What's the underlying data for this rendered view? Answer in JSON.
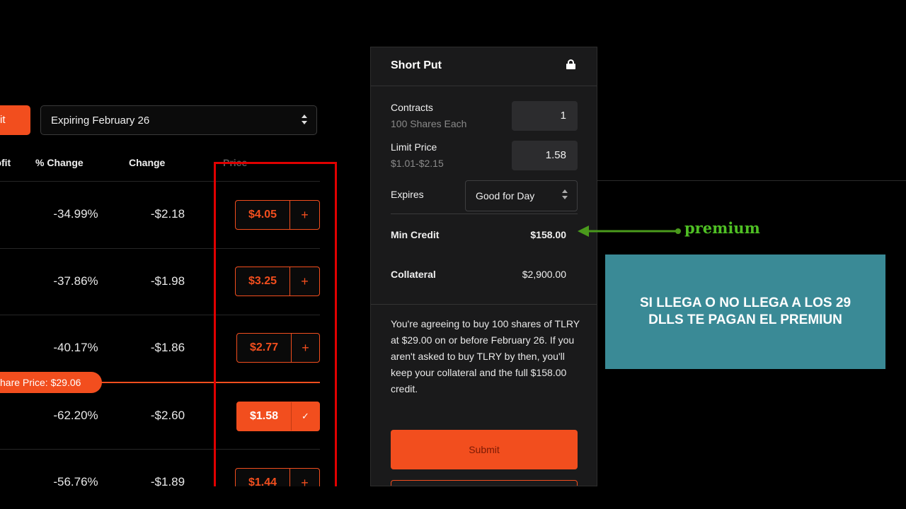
{
  "chain": {
    "left_button_label": "it",
    "expiry_select": "Expiring February 26",
    "columns": {
      "profit": "rofit",
      "pct_change": "% Change",
      "change": "Change",
      "price": "Price"
    },
    "rows": [
      {
        "pct": "-34.99%",
        "chg": "-$2.18",
        "price": "$4.05",
        "action": "+"
      },
      {
        "pct": "-37.86%",
        "chg": "-$1.98",
        "price": "$3.25",
        "action": "+"
      },
      {
        "pct": "-40.17%",
        "chg": "-$1.86",
        "price": "$2.77",
        "action": "+"
      },
      {
        "pct": "-62.20%",
        "chg": "-$2.60",
        "price": "$1.58",
        "action": "✓"
      },
      {
        "pct": "-56.76%",
        "chg": "-$1.89",
        "price": "$1.44",
        "action": "+"
      }
    ],
    "share_price_label": "hare Price: $29.06"
  },
  "panel": {
    "title": "Short Put",
    "contracts_label": "Contracts",
    "contracts_sub": "100 Shares Each",
    "contracts_value": "1",
    "limit_label": "Limit Price",
    "limit_sub": "$1.01-$2.15",
    "limit_value": "1.58",
    "expires_label": "Expires",
    "expires_value": "Good for Day",
    "min_credit_label": "Min Credit",
    "min_credit_value": "$158.00",
    "collateral_label": "Collateral",
    "collateral_value": "$2,900.00",
    "agreement": "You're agreeing to buy 100 shares of TLRY at $29.00 on or before February 26. If you aren't asked to buy TLRY by then, you'll keep your collateral and the full $158.00 credit.",
    "submit_label": "Submit"
  },
  "annotation": {
    "arrow_label": "premium",
    "arrow_color": "#4a9a1c",
    "note": "SI LLEGA O NO LLEGA A LOS 29 DLLS TE PAGAN EL PREMIUN"
  },
  "colors": {
    "accent": "#f24e1e",
    "highlight_box": "#e00000",
    "note_bg": "#3a8a96"
  }
}
